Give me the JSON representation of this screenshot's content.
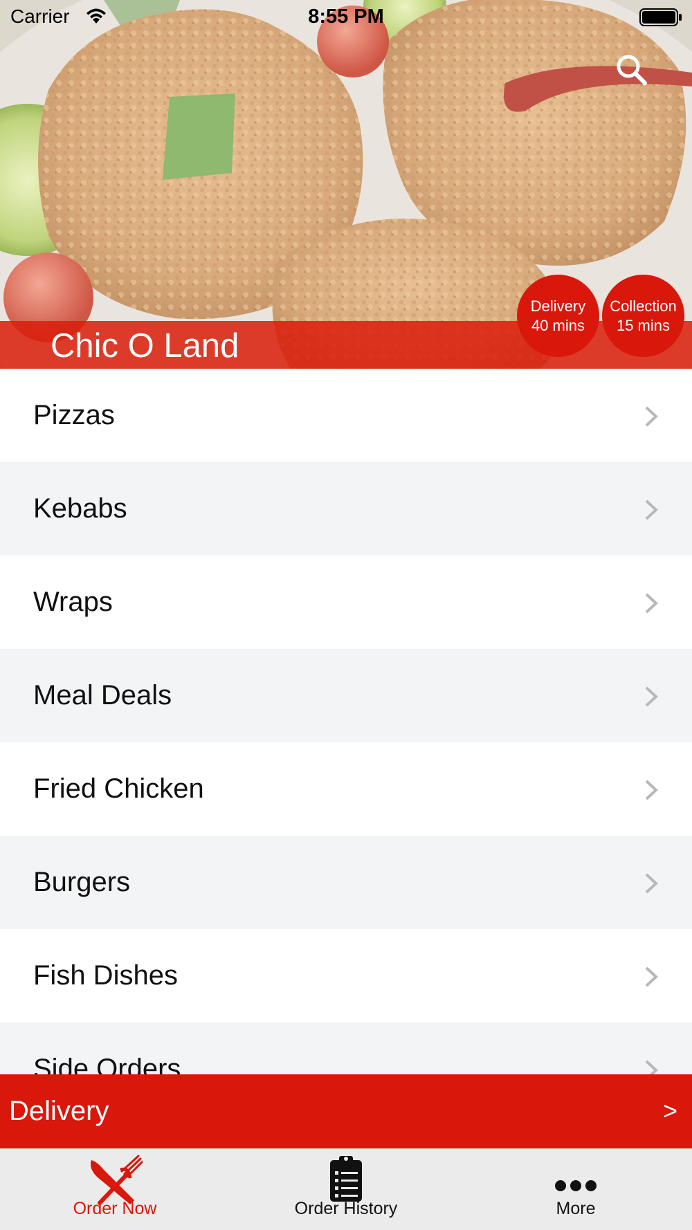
{
  "status_bar": {
    "carrier": "Carrier",
    "time": "8:55 PM"
  },
  "header": {
    "store_name": "Chic O Land",
    "search_icon": "search-icon",
    "delivery_badge": {
      "label": "Delivery",
      "time": "40 mins"
    },
    "collection_badge": {
      "label": "Collection",
      "time": "15 mins"
    }
  },
  "categories": [
    {
      "label": "Pizzas"
    },
    {
      "label": "Kebabs"
    },
    {
      "label": "Wraps"
    },
    {
      "label": "Meal Deals"
    },
    {
      "label": "Fried Chicken"
    },
    {
      "label": "Burgers"
    },
    {
      "label": "Fish Dishes"
    },
    {
      "label": "Side Orders"
    }
  ],
  "delivery_bar": {
    "label": "Delivery",
    "arrow": ">"
  },
  "tab_bar": {
    "tabs": [
      {
        "label": "Order Now",
        "icon": "fork-knife-icon",
        "active": true
      },
      {
        "label": "Order History",
        "icon": "clipboard-list-icon",
        "active": false
      },
      {
        "label": "More",
        "icon": "more-dots-icon",
        "active": false
      }
    ]
  },
  "colors": {
    "brand_red": "#d9170b",
    "row_alt": "#f3f4f6",
    "tab_bar": "#ebebeb"
  }
}
